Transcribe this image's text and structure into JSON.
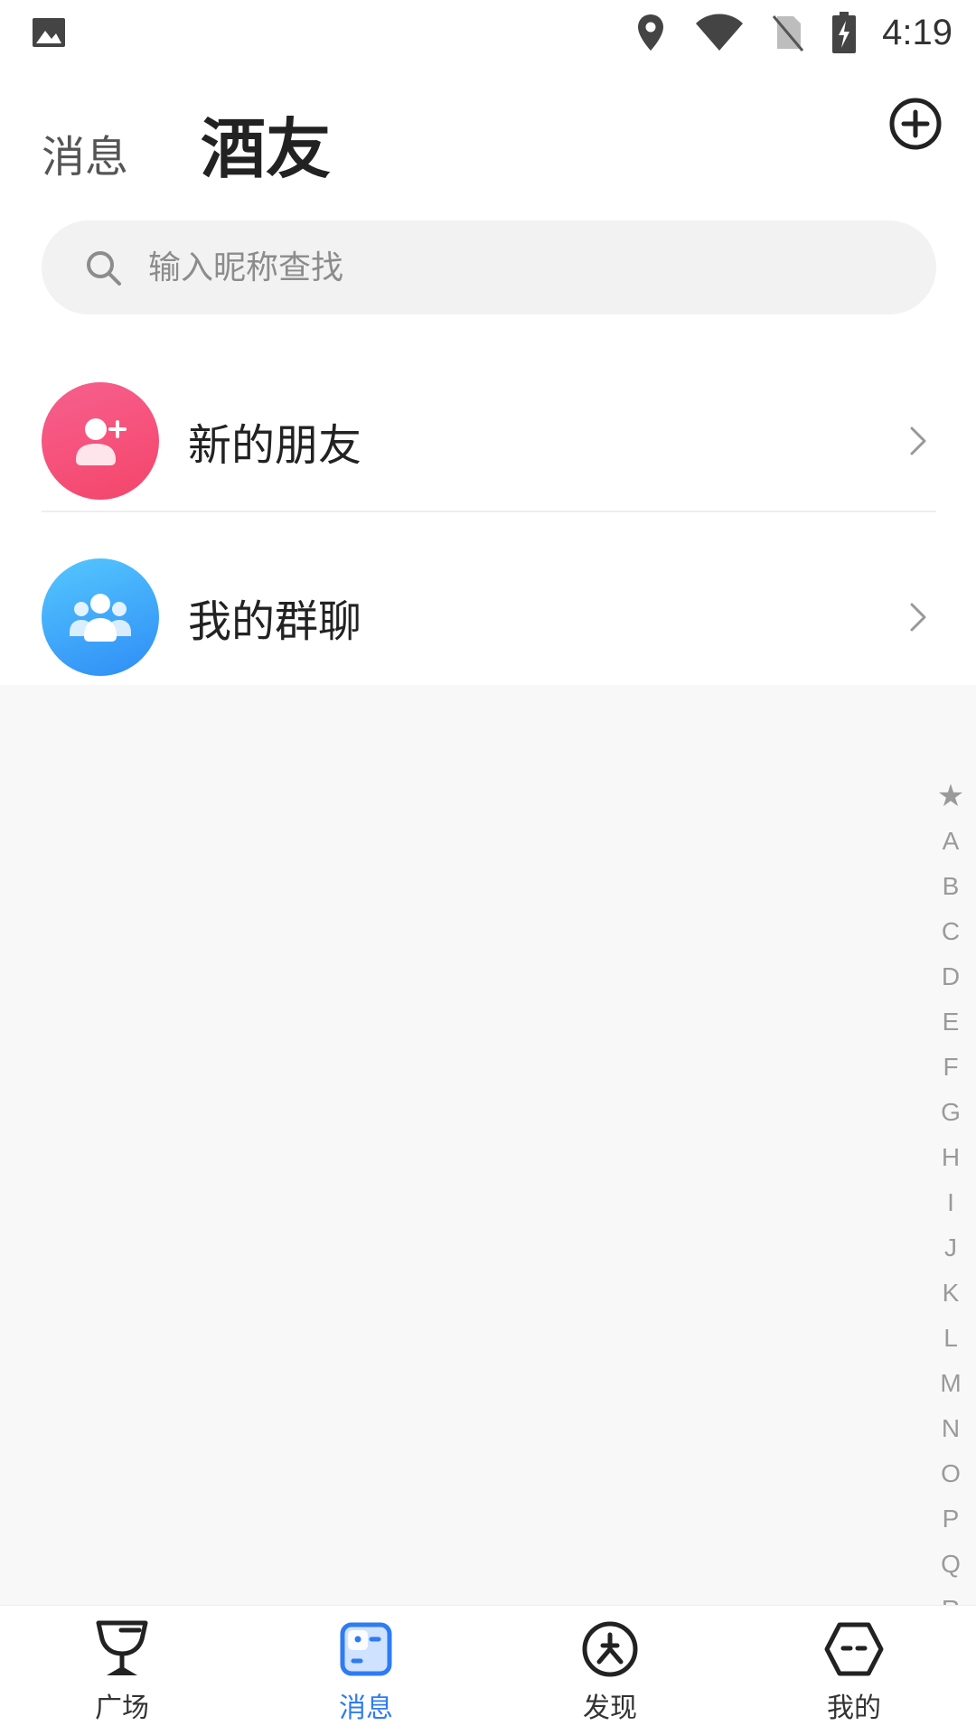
{
  "status_bar": {
    "time": "4:19",
    "icons": [
      "image-icon",
      "location-icon",
      "wifi-icon",
      "no-sim-icon",
      "battery-charging-icon"
    ]
  },
  "header": {
    "tab_messages": "消息",
    "tab_friends": "酒友",
    "add_icon": "add-circle-icon"
  },
  "search": {
    "placeholder": "输入昵称查找",
    "icon": "search-icon"
  },
  "list": {
    "items": [
      {
        "label": "新的朋友",
        "icon": "add-friend-icon",
        "color": "#f4456a"
      },
      {
        "label": "我的群聊",
        "icon": "group-icon",
        "color": "#2e8df5"
      }
    ]
  },
  "alpha_index": {
    "letters": [
      "★",
      "A",
      "B",
      "C",
      "D",
      "E",
      "F",
      "G",
      "H",
      "I",
      "J",
      "K",
      "L",
      "M",
      "N",
      "O",
      "P",
      "Q",
      "R"
    ]
  },
  "bottom_nav": {
    "items": [
      {
        "label": "广场",
        "icon": "wine-glass-icon",
        "active": false
      },
      {
        "label": "消息",
        "icon": "message-icon",
        "active": true
      },
      {
        "label": "发现",
        "icon": "compass-icon",
        "active": false
      },
      {
        "label": "我的",
        "icon": "profile-hexagon-icon",
        "active": false
      }
    ]
  },
  "colors": {
    "accent": "#2f7bf2",
    "background": "#f8f8f8"
  }
}
